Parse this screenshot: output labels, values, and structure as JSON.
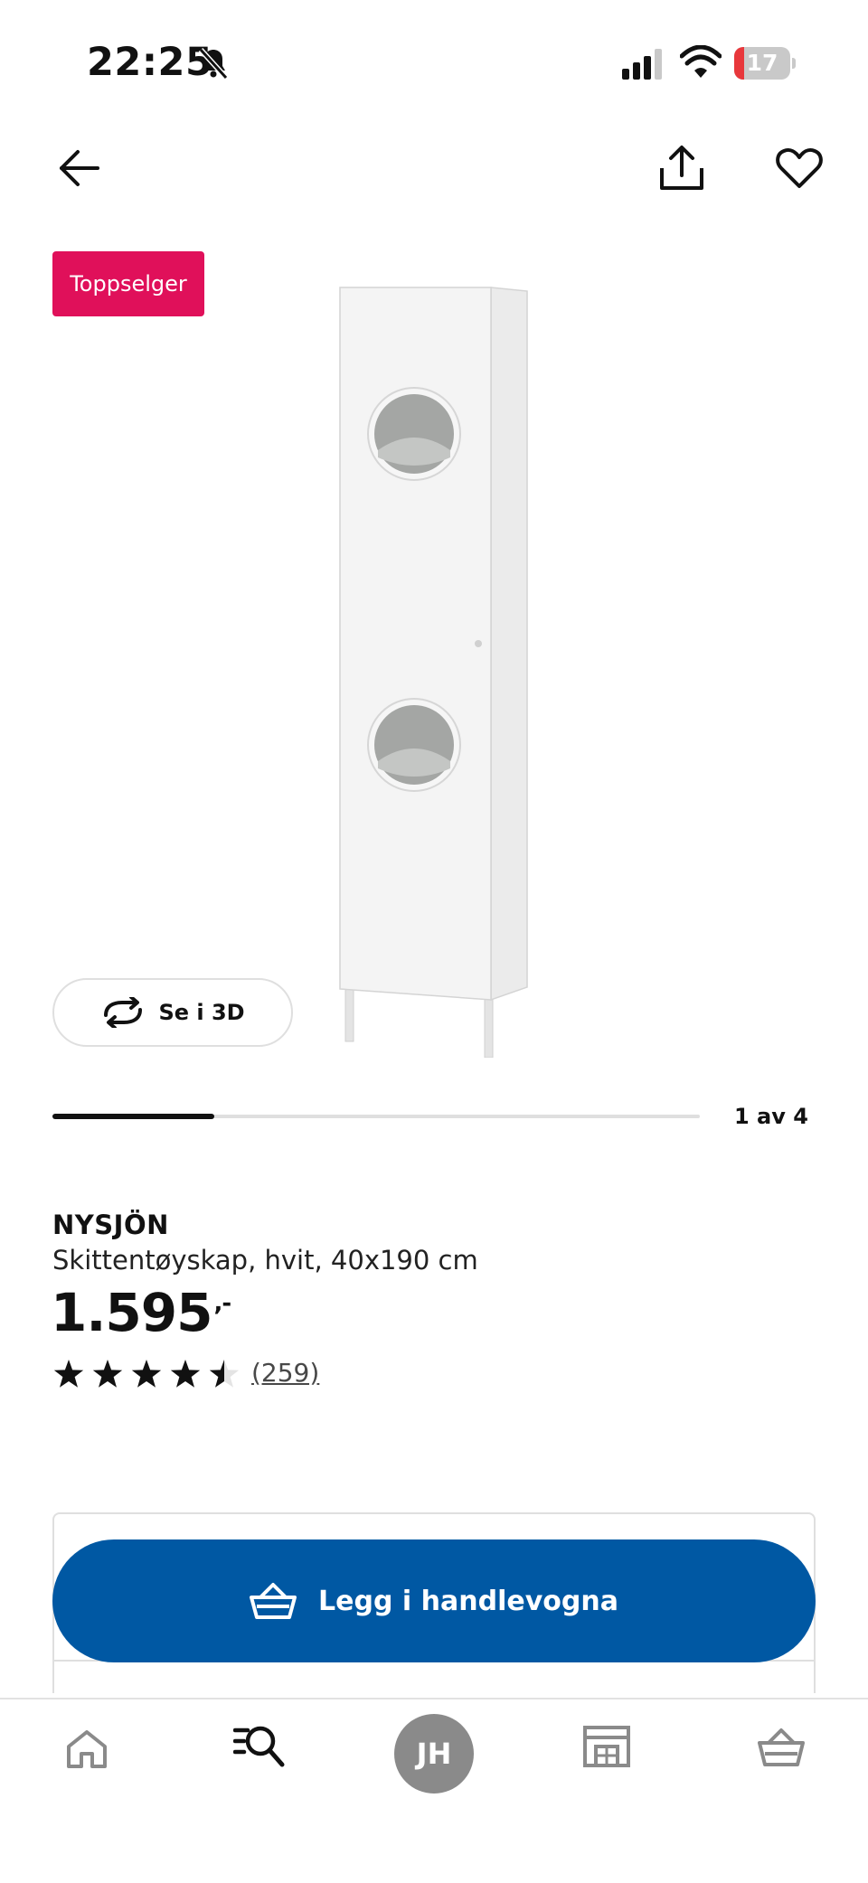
{
  "status_bar": {
    "time": "22:25",
    "battery_level": "17",
    "battery_fraction": 0.17,
    "battery_color": "#e8373b"
  },
  "header": {
    "back_icon": "arrow-left-icon",
    "share_icon": "share-icon",
    "favorite_icon": "heart-icon"
  },
  "gallery": {
    "badge": "Toppselger",
    "badge_color": "#e0105a",
    "view_3d_label": "Se i 3D",
    "view_3d_icon": "rotate-icon",
    "position_label": "1 av 4",
    "current_image": 1,
    "total_images": 4
  },
  "product": {
    "name": "NYSJÖN",
    "description": "Skittentøyskap, hvit, 40x190 cm",
    "price": "1.595",
    "price_suffix": ",-",
    "rating": 4.5,
    "rating_max": 5,
    "review_count": "(259)"
  },
  "cart": {
    "add_label": "Legg i handlevogna",
    "add_icon": "basket-icon",
    "button_color": "#0058a3"
  },
  "bottom_nav": {
    "items": [
      {
        "icon": "home-icon"
      },
      {
        "icon": "search-icon",
        "active": true
      },
      {
        "icon": "avatar",
        "initials": "JH"
      },
      {
        "icon": "store-icon"
      },
      {
        "icon": "cart-icon"
      }
    ]
  }
}
